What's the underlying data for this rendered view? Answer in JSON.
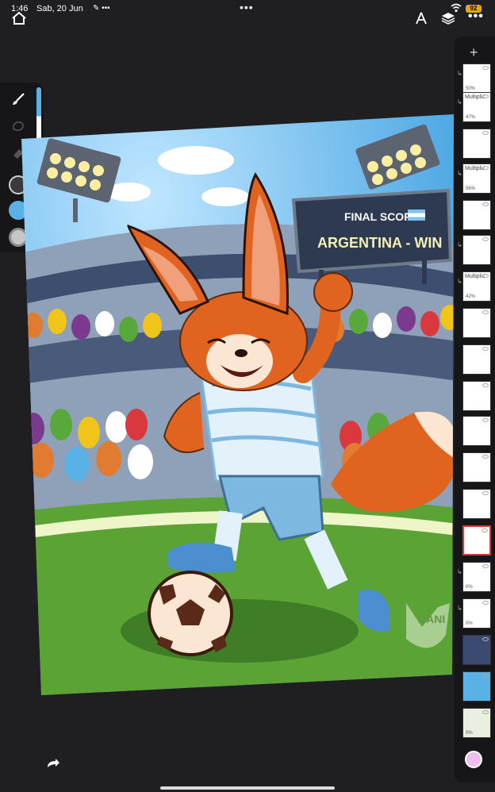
{
  "status_bar": {
    "time": "1:46",
    "date": "Sab, 20 Jun",
    "menu_dots": "•••",
    "battery": "92"
  },
  "toolbar": {
    "more_label": "•••"
  },
  "artwork": {
    "scoreboard_title": "FINAL SCORE",
    "scoreboard_result": "ARGENTINA - WIN",
    "watermark": "DANI"
  },
  "layers": {
    "add_label": "+",
    "items": [
      {
        "blend": "",
        "opacity": "50%"
      },
      {
        "blend": "Multiplic",
        "opacity": "47%"
      },
      {
        "blend": "",
        "opacity": ""
      },
      {
        "blend": "Multiplic",
        "opacity": "56%"
      },
      {
        "blend": "",
        "opacity": ""
      },
      {
        "blend": "",
        "opacity": ""
      },
      {
        "blend": "Multiplic",
        "opacity": "42%"
      },
      {
        "blend": "",
        "opacity": ""
      },
      {
        "blend": "",
        "opacity": ""
      },
      {
        "blend": "",
        "opacity": ""
      },
      {
        "blend": "",
        "opacity": ""
      },
      {
        "blend": "",
        "opacity": ""
      },
      {
        "blend": "",
        "opacity": ""
      },
      {
        "blend": "",
        "opacity": ""
      },
      {
        "blend": "",
        "opacity": "0%"
      },
      {
        "blend": "",
        "opacity": "0%"
      },
      {
        "blend": "",
        "opacity": ""
      },
      {
        "blend": "",
        "opacity": ""
      },
      {
        "blend": "",
        "opacity": "0%"
      }
    ]
  },
  "colors": {
    "current_color": "#5ab1e6",
    "secondary_color": "#f2bcef",
    "app_background": "#1f1f21"
  }
}
